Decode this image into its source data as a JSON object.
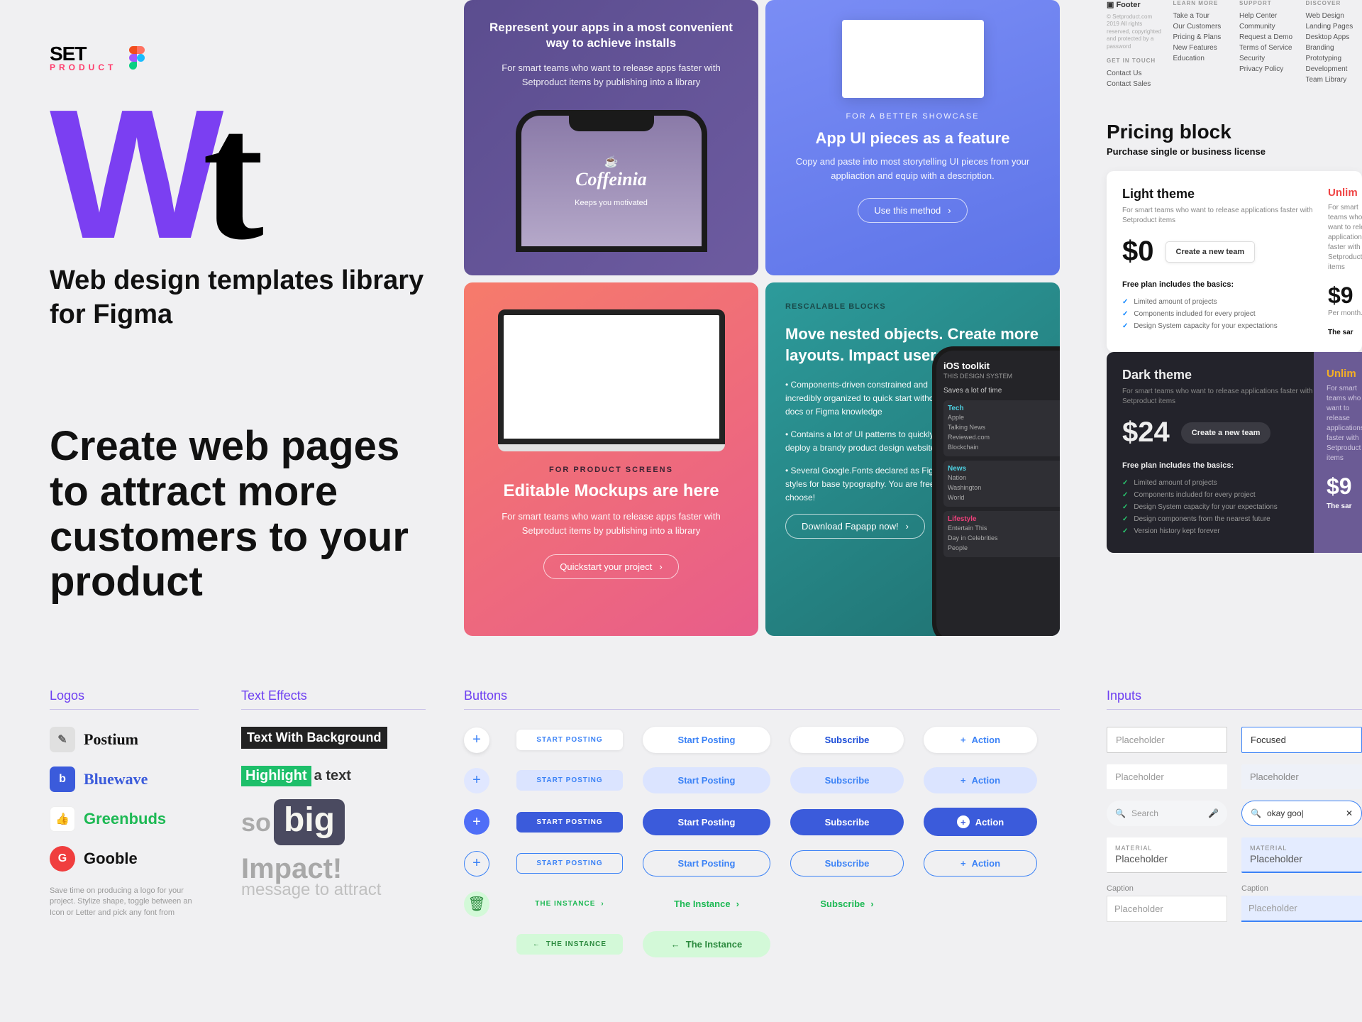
{
  "brand": {
    "top": "SET",
    "bottom": "PRODUCT"
  },
  "wt": {
    "w": "W",
    "t": "t"
  },
  "subtitle": "Web design templates library for Figma",
  "headline": "Create web pages to attract more customers to your product",
  "card1": {
    "title": "Represent your apps in a most convenient way to achieve installs",
    "desc": "For smart teams who want to release apps faster with Setproduct items by publishing into a library",
    "app_name": "Coffeinia",
    "app_sub": "Keeps you motivated"
  },
  "card2": {
    "eyebrow": "FOR A BETTER SHOWCASE",
    "title": "App UI pieces as a feature",
    "desc": "Copy and paste into most storytelling UI pieces from your appliaction and equip with a description.",
    "cta": "Use this method"
  },
  "card3": {
    "eyebrow": "FOR PRODUCT SCREENS",
    "title": "Editable Mockups are here",
    "desc": "For smart teams who want to release apps faster with Setproduct items by publishing into a library",
    "cta": "Quickstart your project"
  },
  "card4": {
    "eyebrow": "RESCALABLE BLOCKS",
    "title": "Move nested objects. Create more layouts. Impact users better.",
    "b1": "• Components-driven constrained and incredibly organized to quick start without docs or Figma knowledge",
    "b2": "• Contains a lot of UI patterns to quickly deploy a brandy product design website",
    "b3": "• Several Google.Fonts declared as Figma styles for base typography. You are free to choose!",
    "cta": "Download Fapapp now!",
    "phone": {
      "title": "iOS toolkit",
      "sub": "THIS DESIGN SYSTEM",
      "sub2": "Saves a lot of time",
      "cat1": "Tech",
      "items1": [
        "Apple",
        "Talking News",
        "Reviewed.com",
        "Blockchain"
      ],
      "cat2": "News",
      "items2": [
        "Nation",
        "Washington",
        "World"
      ],
      "cat3": "Lifestyle",
      "items3": [
        "Entertain This",
        "Day in Celebrities",
        "People"
      ]
    }
  },
  "footer": {
    "logo": "Footer",
    "legal": "© Setproduct.com 2019 All rights reserved, copyrighted and protected by a password",
    "touch_h": "GET IN TOUCH",
    "touch": [
      "Contact Us",
      "Contact Sales"
    ],
    "learn_h": "LEARN MORE",
    "learn": [
      "Take a Tour",
      "Our Customers",
      "Pricing & Plans",
      "New Features",
      "Education"
    ],
    "support_h": "SUPPORT",
    "support": [
      "Help Center",
      "Community",
      "Request a Demo",
      "Terms of Service",
      "Security",
      "Privacy Policy"
    ],
    "discover_h": "DISCOVER",
    "discover": [
      "Web Design",
      "Landing Pages",
      "Desktop Apps",
      "Branding",
      "Prototyping",
      "Development",
      "Team Library"
    ]
  },
  "pricing": {
    "title": "Pricing block",
    "sub": "Purchase single or business license",
    "light": {
      "name": "Light theme",
      "desc": "For smart teams who want to release applications faster with Setproduct items",
      "price": "$0",
      "cta": "Create a new team",
      "incl": "Free plan includes the basics:",
      "features": [
        "Limited amount of projects",
        "Components included for every project",
        "Design System capacity for your expectations"
      ],
      "unl": "Unlim",
      "pr2": "$9",
      "note": "Per month. F",
      "same": "The sar"
    },
    "dark": {
      "name": "Dark theme",
      "desc": "For smart teams who want to release applications faster with Setproduct items",
      "price": "$24",
      "cta": "Create a new team",
      "incl": "Free plan includes the basics:",
      "features": [
        "Limited amount of projects",
        "Components included for every project",
        "Design System capacity for your expectations",
        "Design components from the nearest future",
        "Version history kept forever"
      ],
      "unl": "Unlim",
      "pr2": "$9",
      "same": "The sar"
    }
  },
  "sections": {
    "logos": "Logos",
    "text": "Text Effects",
    "buttons": "Buttons",
    "inputs": "Inputs"
  },
  "logos": [
    {
      "name": "Postium",
      "bg": "#e0e0e0",
      "icon": "✎",
      "color": "#111",
      "style": "serif"
    },
    {
      "name": "Bluewave",
      "bg": "#3b5bdb",
      "icon": "b",
      "color": "#3b5bdb",
      "style": "serif"
    },
    {
      "name": "Greenbuds",
      "bg": "#fff",
      "icon": "👍",
      "color": "#1db954",
      "style": "sans"
    },
    {
      "name": "Gooble",
      "bg": "#f03e3e",
      "icon": "G",
      "color": "#111",
      "style": "sans"
    }
  ],
  "logos_caption": "Save time on producing a logo for your project. Stylize shape, toggle between an Icon or Letter and pick any font from",
  "text_effects": {
    "te1": "Text With Background",
    "te2a": "Highlight",
    "te2b": "a text",
    "te3a": "so",
    "te3b": "big",
    "te4a": "Impact!",
    "te4b": "message to attract"
  },
  "buttons": {
    "c2": [
      "START POSTING",
      "START POSTING",
      "START POSTING",
      "START POSTING",
      "THE INSTANCE",
      "THE INSTANCE"
    ],
    "c3": [
      "Start Posting",
      "Start Posting",
      "Start Posting",
      "Start Posting",
      "The Instance",
      "The Instance"
    ],
    "c4": [
      "Subscribe",
      "Subscribe",
      "Subscribe",
      "Subscribe",
      "Subscribe"
    ],
    "c5": "Action"
  },
  "inputs": {
    "ph": "Placeholder",
    "foc": "Focused",
    "search": "Search",
    "goog": "okay goo|",
    "mat": "MATERIAL",
    "cap": "Caption"
  }
}
